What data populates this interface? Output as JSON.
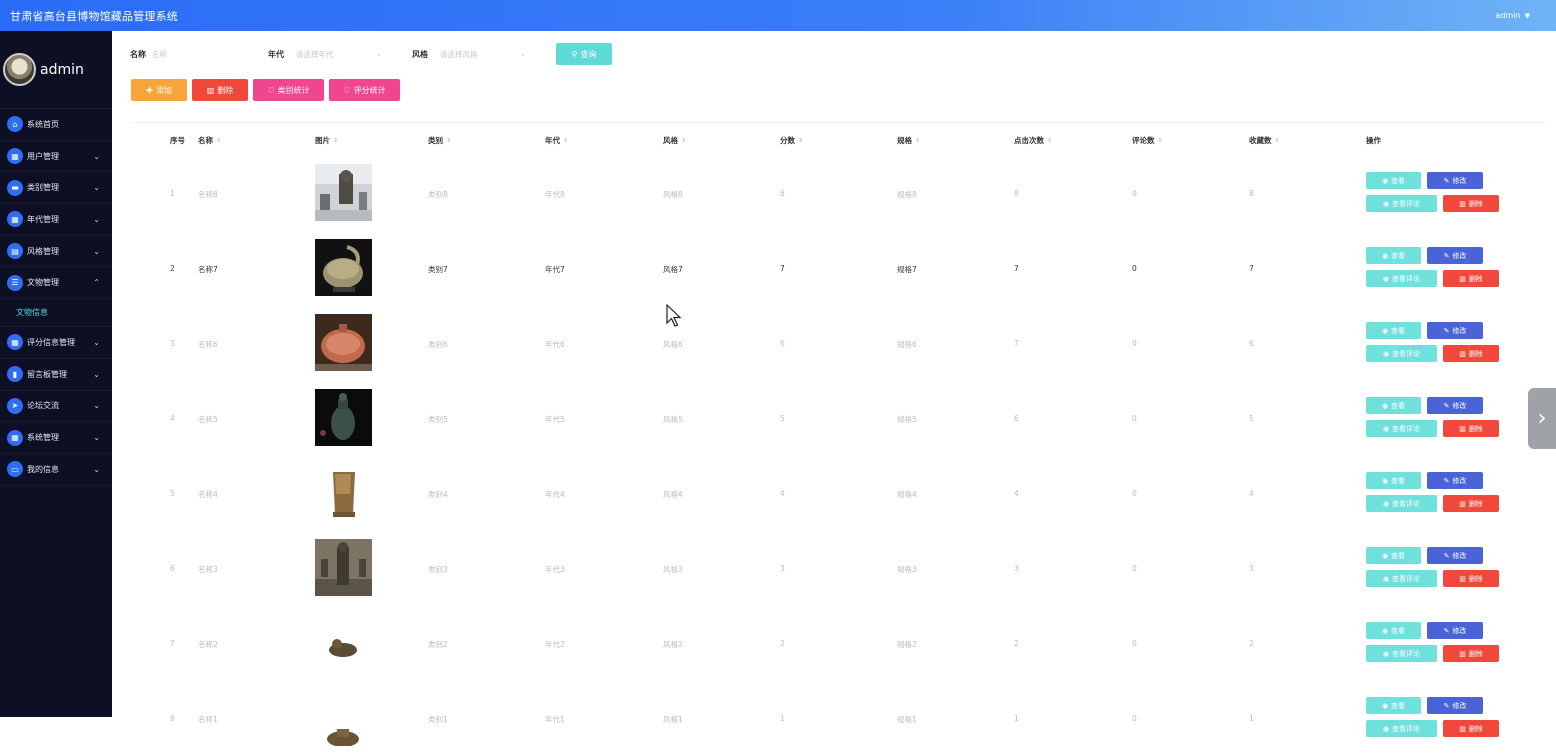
{
  "header": {
    "title": "甘肃省高台县博物馆藏品管理系统",
    "user": "admin"
  },
  "sidebar": {
    "username": "admin",
    "items": [
      {
        "label": "系统首页",
        "icon": "home-icon",
        "chev": ""
      },
      {
        "label": "用户管理",
        "icon": "grid-icon",
        "chev": "⌄"
      },
      {
        "label": "类别管理",
        "icon": "chat-icon",
        "chev": "⌄"
      },
      {
        "label": "年代管理",
        "icon": "grid-icon",
        "chev": "⌄"
      },
      {
        "label": "风格管理",
        "icon": "doc-icon",
        "chev": "⌄"
      },
      {
        "label": "文物管理",
        "icon": "list-icon",
        "chev": "⌃"
      },
      {
        "label": "评分信息管理",
        "icon": "grid-icon",
        "chev": "⌄"
      },
      {
        "label": "留言板管理",
        "icon": "book-icon",
        "chev": "⌄"
      },
      {
        "label": "论坛交流",
        "icon": "send-icon",
        "chev": "⌄"
      },
      {
        "label": "系统管理",
        "icon": "grid-icon",
        "chev": "⌄"
      },
      {
        "label": "我的信息",
        "icon": "card-icon",
        "chev": "⌄"
      }
    ],
    "submenu_label": "文物信息"
  },
  "search": {
    "name_label": "名称",
    "name_placeholder": "名称",
    "era_label": "年代",
    "era_placeholder": "请选择年代",
    "style_label": "风格",
    "style_placeholder": "请选择风格",
    "query_label": "查询"
  },
  "toolbar": {
    "add": "添加",
    "delete": "删除",
    "category_stats": "类别统计",
    "score_stats": "评分统计"
  },
  "table": {
    "headers": {
      "index": "序号",
      "name": "名称",
      "image": "图片",
      "category": "类别",
      "era": "年代",
      "style": "风格",
      "score": "分数",
      "spec": "规格",
      "clicks": "点击次数",
      "comments": "评论数",
      "favorites": "收藏数",
      "ops": "操作"
    },
    "ops": {
      "view": "查看",
      "edit": "修改",
      "view_comments": "查看评论",
      "delete": "删除"
    },
    "rows": [
      {
        "index": "1",
        "name": "名称8",
        "category": "类别8",
        "era": "年代8",
        "style": "风格8",
        "score": "8",
        "spec": "规格8",
        "clicks": "8",
        "comments": "0",
        "favorites": "8"
      },
      {
        "index": "2",
        "name": "名称7",
        "category": "类别7",
        "era": "年代7",
        "style": "风格7",
        "score": "7",
        "spec": "规格7",
        "clicks": "7",
        "comments": "0",
        "favorites": "7"
      },
      {
        "index": "3",
        "name": "名称6",
        "category": "类别6",
        "era": "年代6",
        "style": "风格6",
        "score": "6",
        "spec": "规格6",
        "clicks": "7",
        "comments": "0",
        "favorites": "6"
      },
      {
        "index": "4",
        "name": "名称5",
        "category": "类别5",
        "era": "年代5",
        "style": "风格5",
        "score": "5",
        "spec": "规格5",
        "clicks": "6",
        "comments": "0",
        "favorites": "5"
      },
      {
        "index": "5",
        "name": "名称4",
        "category": "类别4",
        "era": "年代4",
        "style": "风格4",
        "score": "4",
        "spec": "规格4",
        "clicks": "4",
        "comments": "0",
        "favorites": "4"
      },
      {
        "index": "6",
        "name": "名称3",
        "category": "类别3",
        "era": "年代3",
        "style": "风格3",
        "score": "3",
        "spec": "规格3",
        "clicks": "3",
        "comments": "0",
        "favorites": "3"
      },
      {
        "index": "7",
        "name": "名称2",
        "category": "类别2",
        "era": "年代2",
        "style": "风格2",
        "score": "2",
        "spec": "规格2",
        "clicks": "2",
        "comments": "0",
        "favorites": "2"
      },
      {
        "index": "8",
        "name": "名称1",
        "category": "类别1",
        "era": "年代1",
        "style": "风格1",
        "score": "1",
        "spec": "规格1",
        "clicks": "1",
        "comments": "0",
        "favorites": "1"
      }
    ]
  },
  "colors": {
    "accent": "#2f6df5",
    "teal": "#5fdbd7",
    "red": "#f0483b",
    "pink": "#f0458f",
    "orange": "#f6a53b",
    "indigo": "#4a64d8",
    "sidebar_bg": "#0d1024"
  }
}
